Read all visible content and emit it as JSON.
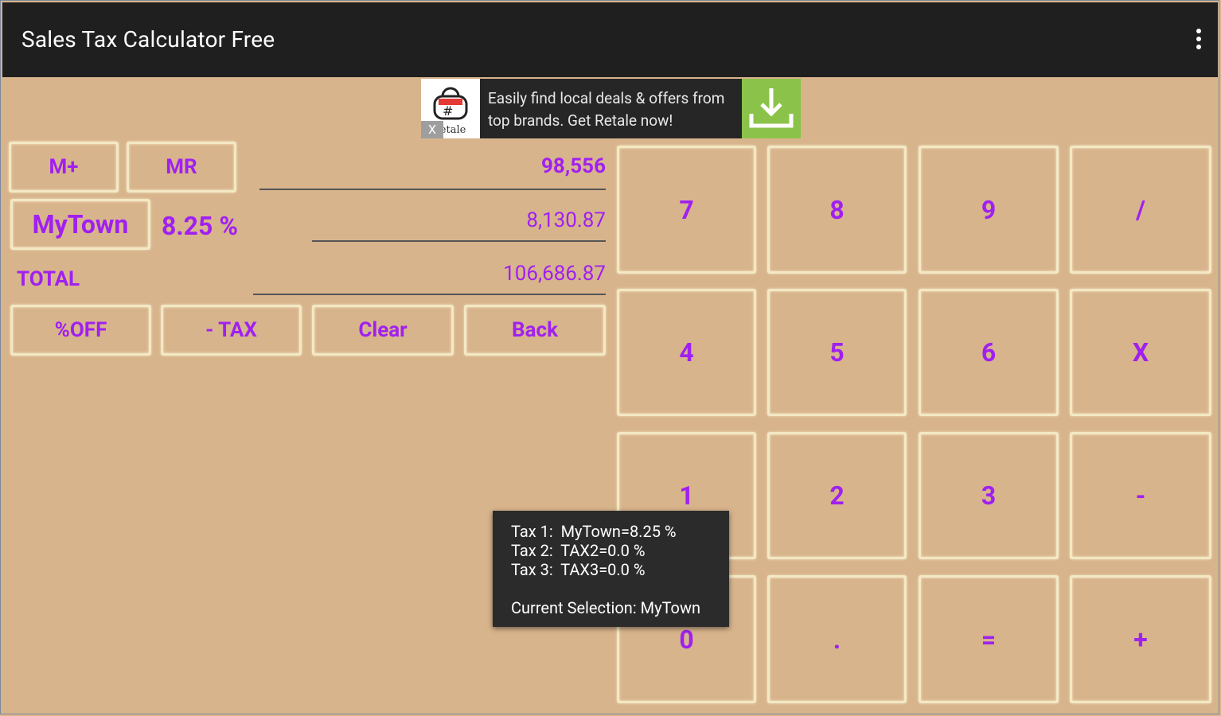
{
  "app": {
    "title": "Sales Tax Calculator Free"
  },
  "ad": {
    "text": "Easily find local deals & offers from top brands. Get Retale now!",
    "brand": "Retale",
    "close": "X"
  },
  "memory": {
    "m_plus": "M+",
    "mr": "MR"
  },
  "display": {
    "amount": "98,556",
    "tax_amount": "8,130.87",
    "total_label": "TOTAL",
    "total": "106,686.87"
  },
  "tax": {
    "name": "MyTown",
    "rate": "8.25 %"
  },
  "actions": {
    "off": "%OFF",
    "minus_tax": "- TAX",
    "clear": "Clear",
    "back": "Back"
  },
  "keypad": {
    "k7": "7",
    "k8": "8",
    "k9": "9",
    "div": "/",
    "k4": "4",
    "k5": "5",
    "k6": "6",
    "mul": "X",
    "k1": "1",
    "k2": "2",
    "k3": "3",
    "sub": "-",
    "k0": "0",
    "dot": ".",
    "eq": "=",
    "add": "+"
  },
  "toast": {
    "line1": "Tax 1:  MyTown=8.25 %",
    "line2": "Tax 2:  TAX2=0.0 %",
    "line3": "Tax 3:  TAX3=0.0 %",
    "line4": "Current Selection: MyTown"
  },
  "colors": {
    "background": "#d8b48c",
    "accent": "#a020f0",
    "appbar": "#1f1f1f",
    "ad_download": "#8bc34a"
  }
}
